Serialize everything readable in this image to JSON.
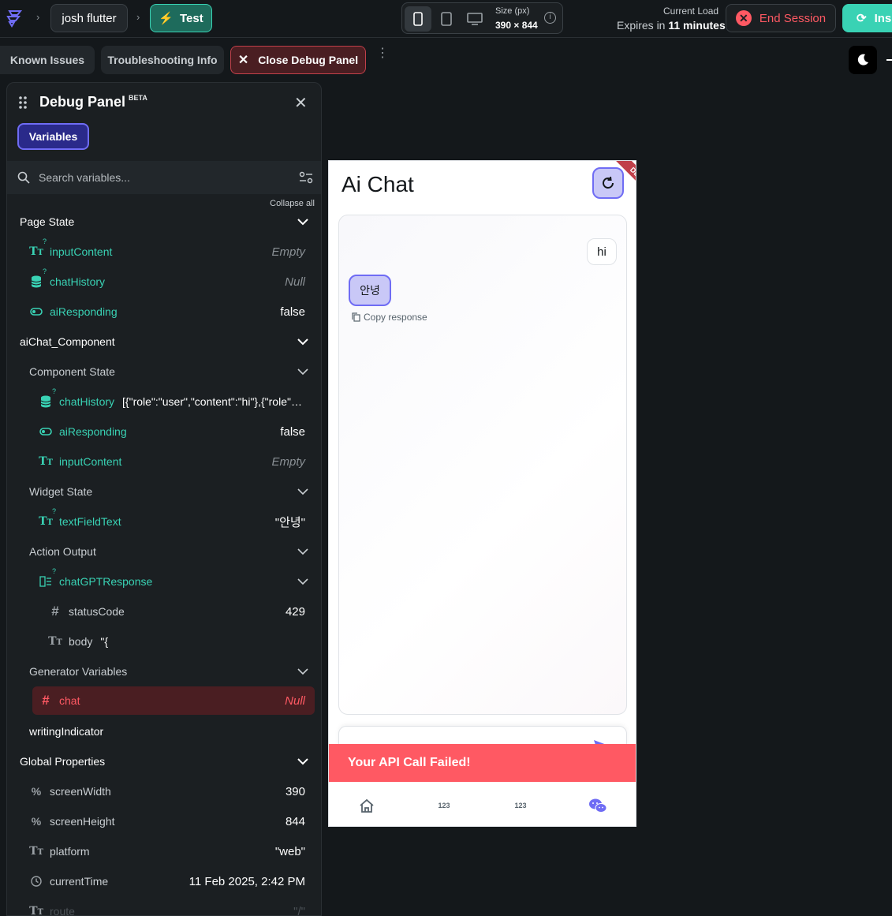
{
  "topbar": {
    "project": "josh flutter",
    "mode": "Test",
    "size_label": "Size (px)",
    "size_value": "390 × 844",
    "load_label": "Current Load",
    "expires_prefix": "Expires in",
    "expires_value": "11 minutes",
    "end_session": "End Session",
    "inspect": "Ins"
  },
  "toolbar": {
    "known_issues": "Known Issues",
    "troubleshooting": "Troubleshooting Info",
    "close_debug": "Close Debug Panel"
  },
  "panel": {
    "title": "Debug Panel",
    "beta": "BETA",
    "tab": "Variables",
    "search_placeholder": "Search variables...",
    "collapse_all": "Collapse all",
    "rows": [
      {
        "kind": "section",
        "label": "Page State"
      },
      {
        "kind": "var",
        "indent": 1,
        "icon": "text-icon",
        "optional": true,
        "label": "inputContent",
        "value": "Empty",
        "style": "muted"
      },
      {
        "kind": "var",
        "indent": 1,
        "icon": "database-icon",
        "optional": true,
        "label": "chatHistory",
        "value": "Null",
        "style": "muted"
      },
      {
        "kind": "var",
        "indent": 1,
        "icon": "toggle-icon",
        "optional": false,
        "label": "aiResponding",
        "value": "false",
        "style": "plain"
      },
      {
        "kind": "section",
        "label": "aiChat_Component"
      },
      {
        "kind": "subsection",
        "label": "Component State"
      },
      {
        "kind": "var",
        "indent": 2,
        "icon": "database-icon",
        "optional": true,
        "label": "chatHistory",
        "value": "[{\"role\":\"user\",\"content\":\"hi\"},{\"role\":\"...",
        "style": "plain-left"
      },
      {
        "kind": "var",
        "indent": 2,
        "icon": "toggle-icon",
        "optional": false,
        "label": "aiResponding",
        "value": "false",
        "style": "plain"
      },
      {
        "kind": "var",
        "indent": 2,
        "icon": "text-icon",
        "optional": false,
        "label": "inputContent",
        "value": "Empty",
        "style": "muted"
      },
      {
        "kind": "subsection",
        "label": "Widget State"
      },
      {
        "kind": "var",
        "indent": 2,
        "icon": "text-icon",
        "optional": true,
        "label": "textFieldText",
        "value": "\"안녕\"",
        "style": "plain"
      },
      {
        "kind": "subsection",
        "label": "Action Output"
      },
      {
        "kind": "var",
        "indent": 2,
        "icon": "json-icon",
        "optional": true,
        "label": "chatGPTResponse",
        "value": "",
        "style": "chevron"
      },
      {
        "kind": "var",
        "indent": 3,
        "icon": "hash-icon",
        "optional": false,
        "label": "statusCode",
        "value": "429",
        "style": "plain",
        "grey": true
      },
      {
        "kind": "var",
        "indent": 3,
        "icon": "text-icon",
        "optional": false,
        "label": "body",
        "value": "\"{",
        "style": "plain-left",
        "grey": true
      },
      {
        "kind": "subsection",
        "label": "Generator Variables"
      },
      {
        "kind": "var",
        "indent": 2,
        "icon": "hash-icon",
        "optional": false,
        "label": "chat",
        "value": "Null",
        "style": "error"
      },
      {
        "kind": "leaf",
        "label": "writingIndicator"
      },
      {
        "kind": "section",
        "label": "Global Properties"
      },
      {
        "kind": "var",
        "indent": 1,
        "icon": "percent-icon",
        "optional": false,
        "label": "screenWidth",
        "value": "390",
        "style": "plain",
        "grey": true
      },
      {
        "kind": "var",
        "indent": 1,
        "icon": "percent-icon",
        "optional": false,
        "label": "screenHeight",
        "value": "844",
        "style": "plain",
        "grey": true
      },
      {
        "kind": "var",
        "indent": 1,
        "icon": "text-icon",
        "optional": false,
        "label": "platform",
        "value": "\"web\"",
        "style": "plain",
        "grey": true
      },
      {
        "kind": "var",
        "indent": 1,
        "icon": "clock-icon",
        "optional": false,
        "label": "currentTime",
        "value": "11 Feb 2025, 2:42 PM",
        "style": "plain",
        "grey": true
      },
      {
        "kind": "var",
        "indent": 1,
        "icon": "text-icon",
        "optional": false,
        "label": "route",
        "value": "\"/\"",
        "style": "faded",
        "grey": true
      }
    ]
  },
  "preview": {
    "title": "Ai Chat",
    "debug_ribbon": "DEBUG",
    "user_message": "hi",
    "ai_message": "안녕",
    "copy_response": "Copy response",
    "error": "Your API Call Failed!",
    "nav": [
      "home-icon",
      "123",
      "123",
      "wechat-icon"
    ]
  },
  "colors": {
    "accent": "#39d2b4",
    "primary": "#6f6cf4",
    "error": "#ff5963",
    "bg": "#14181b"
  }
}
